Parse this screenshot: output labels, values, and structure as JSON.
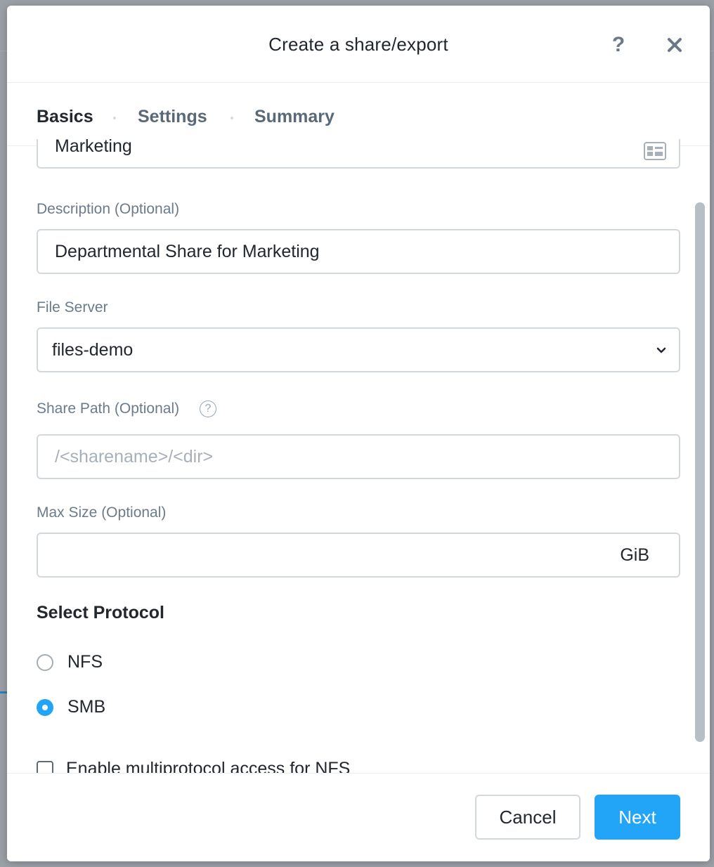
{
  "modal": {
    "title": "Create a share/export",
    "help_icon": "question-icon",
    "close_icon": "close-icon"
  },
  "tabs": [
    {
      "label": "Basics",
      "active": true
    },
    {
      "label": "Settings",
      "active": false
    },
    {
      "label": "Summary",
      "active": false
    }
  ],
  "form": {
    "name": {
      "value": "Marketing",
      "icon": "contact-card-icon"
    },
    "description": {
      "label": "Description (Optional)",
      "value": "Departmental Share for Marketing"
    },
    "file_server": {
      "label": "File Server",
      "value": "files-demo"
    },
    "share_path": {
      "label": "Share Path (Optional)",
      "placeholder": "/<sharename>/<dir>",
      "help_glyph": "?"
    },
    "max_size": {
      "label": "Max Size (Optional)",
      "unit": "GiB"
    },
    "protocol": {
      "title": "Select Protocol",
      "options": [
        {
          "label": "NFS",
          "selected": false
        },
        {
          "label": "SMB",
          "selected": true
        }
      ]
    },
    "multiprotocol": {
      "label": "Enable multiprotocol access for NFS",
      "checked": false
    }
  },
  "footer": {
    "cancel_label": "Cancel",
    "next_label": "Next"
  },
  "colors": {
    "accent": "#22a5f7",
    "text": "#22272e",
    "label": "#6b7b8b"
  }
}
